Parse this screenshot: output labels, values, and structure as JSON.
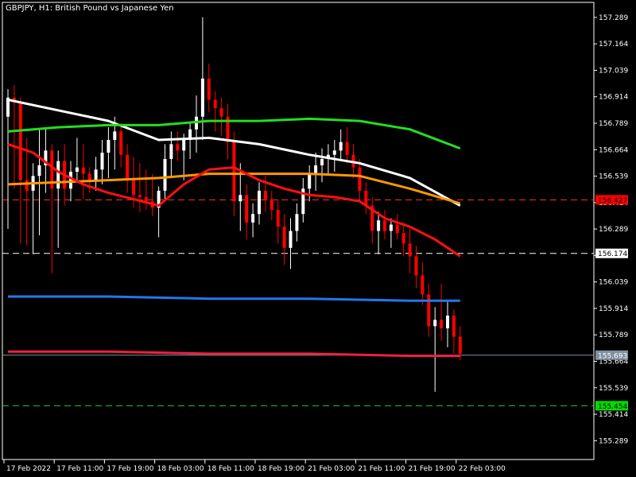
{
  "title": "GBPJPY, H1:  British Pound vs Japanese Yen",
  "colors": {
    "background": "#000000",
    "frame": "#ffffff",
    "bull_candle": "#ffffff",
    "bear_candle": "#ff0000",
    "current_price_line": "#8090a0",
    "ma_white": "#ffffff",
    "ma_green": "#22dd22",
    "ma_orange": "#ff9900",
    "ma_red": "#ff1010",
    "ma_blue": "#2277ee",
    "ma_crimson": "#ee2040"
  },
  "chart_data": {
    "type": "candlestick",
    "instrument": "GBPJPY",
    "timeframe": "H1",
    "ylim": [
      155.2,
      157.36
    ],
    "y_ticks": [
      "157.289",
      "157.164",
      "157.039",
      "156.914",
      "156.789",
      "156.664",
      "156.539",
      "156.414",
      "156.289",
      "156.164",
      "156.039",
      "155.914",
      "155.789",
      "155.664",
      "155.539",
      "155.414",
      "155.289"
    ],
    "x_ticks": [
      {
        "label": "17 Feb 2022",
        "bar": 0
      },
      {
        "label": "17 Feb 11:00",
        "bar": 8
      },
      {
        "label": "17 Feb 19:00",
        "bar": 16
      },
      {
        "label": "18 Feb 03:00",
        "bar": 24
      },
      {
        "label": "18 Feb 11:00",
        "bar": 32
      },
      {
        "label": "18 Feb 19:00",
        "bar": 40
      },
      {
        "label": "21 Feb 03:00",
        "bar": 48
      },
      {
        "label": "21 Feb 11:00",
        "bar": 56
      },
      {
        "label": "21 Feb 19:00",
        "bar": 64
      },
      {
        "label": "22 Feb 03:00",
        "bar": 72
      }
    ],
    "candles": [
      {
        "o": 156.82,
        "h": 156.95,
        "l": 156.29,
        "c": 156.91
      },
      {
        "o": 156.91,
        "h": 156.97,
        "l": 156.48,
        "c": 156.89
      },
      {
        "o": 156.89,
        "h": 156.91,
        "l": 156.22,
        "c": 156.52
      },
      {
        "o": 156.52,
        "h": 156.72,
        "l": 156.21,
        "c": 156.47
      },
      {
        "o": 156.47,
        "h": 156.6,
        "l": 156.17,
        "c": 156.54
      },
      {
        "o": 156.54,
        "h": 156.76,
        "l": 156.26,
        "c": 156.59
      },
      {
        "o": 156.59,
        "h": 156.77,
        "l": 156.46,
        "c": 156.66
      },
      {
        "o": 156.66,
        "h": 156.69,
        "l": 156.08,
        "c": 156.48
      },
      {
        "o": 156.48,
        "h": 156.66,
        "l": 156.2,
        "c": 156.61
      },
      {
        "o": 156.61,
        "h": 156.69,
        "l": 156.4,
        "c": 156.48
      },
      {
        "o": 156.48,
        "h": 156.61,
        "l": 156.42,
        "c": 156.56
      },
      {
        "o": 156.56,
        "h": 156.72,
        "l": 156.52,
        "c": 156.58
      },
      {
        "o": 156.58,
        "h": 156.69,
        "l": 156.43,
        "c": 156.55
      },
      {
        "o": 156.55,
        "h": 156.58,
        "l": 156.46,
        "c": 156.52
      },
      {
        "o": 156.52,
        "h": 156.63,
        "l": 156.47,
        "c": 156.57
      },
      {
        "o": 156.57,
        "h": 156.71,
        "l": 156.5,
        "c": 156.65
      },
      {
        "o": 156.65,
        "h": 156.77,
        "l": 156.53,
        "c": 156.71
      },
      {
        "o": 156.71,
        "h": 156.82,
        "l": 156.57,
        "c": 156.75
      },
      {
        "o": 156.75,
        "h": 156.79,
        "l": 156.58,
        "c": 156.64
      },
      {
        "o": 156.64,
        "h": 156.69,
        "l": 156.46,
        "c": 156.52
      },
      {
        "o": 156.52,
        "h": 156.63,
        "l": 156.39,
        "c": 156.45
      },
      {
        "o": 156.45,
        "h": 156.6,
        "l": 156.37,
        "c": 156.44
      },
      {
        "o": 156.44,
        "h": 156.57,
        "l": 156.38,
        "c": 156.42
      },
      {
        "o": 156.42,
        "h": 156.55,
        "l": 156.35,
        "c": 156.39
      },
      {
        "o": 156.39,
        "h": 156.49,
        "l": 156.25,
        "c": 156.47
      },
      {
        "o": 156.47,
        "h": 156.69,
        "l": 156.42,
        "c": 156.62
      },
      {
        "o": 156.62,
        "h": 156.75,
        "l": 156.53,
        "c": 156.69
      },
      {
        "o": 156.69,
        "h": 156.75,
        "l": 156.61,
        "c": 156.66
      },
      {
        "o": 156.66,
        "h": 156.74,
        "l": 156.52,
        "c": 156.71
      },
      {
        "o": 156.71,
        "h": 156.79,
        "l": 156.62,
        "c": 156.76
      },
      {
        "o": 156.76,
        "h": 156.92,
        "l": 156.65,
        "c": 156.82
      },
      {
        "o": 156.82,
        "h": 157.29,
        "l": 156.71,
        "c": 157.0
      },
      {
        "o": 157.0,
        "h": 157.07,
        "l": 156.84,
        "c": 156.9
      },
      {
        "o": 156.9,
        "h": 156.94,
        "l": 156.75,
        "c": 156.86
      },
      {
        "o": 156.86,
        "h": 156.91,
        "l": 156.73,
        "c": 156.82
      },
      {
        "o": 156.82,
        "h": 156.88,
        "l": 156.62,
        "c": 156.7
      },
      {
        "o": 156.7,
        "h": 156.75,
        "l": 156.35,
        "c": 156.42
      },
      {
        "o": 156.42,
        "h": 156.6,
        "l": 156.28,
        "c": 156.45
      },
      {
        "o": 156.45,
        "h": 156.5,
        "l": 156.24,
        "c": 156.32
      },
      {
        "o": 156.32,
        "h": 156.41,
        "l": 156.25,
        "c": 156.36
      },
      {
        "o": 156.36,
        "h": 156.51,
        "l": 156.31,
        "c": 156.47
      },
      {
        "o": 156.47,
        "h": 156.54,
        "l": 156.37,
        "c": 156.43
      },
      {
        "o": 156.43,
        "h": 156.47,
        "l": 156.33,
        "c": 156.38
      },
      {
        "o": 156.38,
        "h": 156.43,
        "l": 156.22,
        "c": 156.3
      },
      {
        "o": 156.3,
        "h": 156.36,
        "l": 156.12,
        "c": 156.2
      },
      {
        "o": 156.2,
        "h": 156.34,
        "l": 156.1,
        "c": 156.28
      },
      {
        "o": 156.28,
        "h": 156.41,
        "l": 156.23,
        "c": 156.36
      },
      {
        "o": 156.36,
        "h": 156.53,
        "l": 156.32,
        "c": 156.48
      },
      {
        "o": 156.48,
        "h": 156.59,
        "l": 156.42,
        "c": 156.55
      },
      {
        "o": 156.55,
        "h": 156.65,
        "l": 156.47,
        "c": 156.59
      },
      {
        "o": 156.59,
        "h": 156.67,
        "l": 156.51,
        "c": 156.62
      },
      {
        "o": 156.62,
        "h": 156.69,
        "l": 156.55,
        "c": 156.64
      },
      {
        "o": 156.64,
        "h": 156.71,
        "l": 156.56,
        "c": 156.66
      },
      {
        "o": 156.66,
        "h": 156.76,
        "l": 156.61,
        "c": 156.7
      },
      {
        "o": 156.7,
        "h": 156.77,
        "l": 156.6,
        "c": 156.64
      },
      {
        "o": 156.64,
        "h": 156.69,
        "l": 156.53,
        "c": 156.58
      },
      {
        "o": 156.58,
        "h": 156.62,
        "l": 156.42,
        "c": 156.47
      },
      {
        "o": 156.47,
        "h": 156.51,
        "l": 156.36,
        "c": 156.4
      },
      {
        "o": 156.4,
        "h": 156.44,
        "l": 156.22,
        "c": 156.28
      },
      {
        "o": 156.28,
        "h": 156.37,
        "l": 156.17,
        "c": 156.33
      },
      {
        "o": 156.33,
        "h": 156.38,
        "l": 156.24,
        "c": 156.28
      },
      {
        "o": 156.28,
        "h": 156.34,
        "l": 156.2,
        "c": 156.31
      },
      {
        "o": 156.31,
        "h": 156.36,
        "l": 156.24,
        "c": 156.27
      },
      {
        "o": 156.27,
        "h": 156.32,
        "l": 156.16,
        "c": 156.22
      },
      {
        "o": 156.22,
        "h": 156.29,
        "l": 156.08,
        "c": 156.16
      },
      {
        "o": 156.16,
        "h": 156.21,
        "l": 156.01,
        "c": 156.07
      },
      {
        "o": 156.07,
        "h": 156.13,
        "l": 155.93,
        "c": 155.98
      },
      {
        "o": 155.98,
        "h": 156.03,
        "l": 155.78,
        "c": 155.83
      },
      {
        "o": 155.83,
        "h": 155.92,
        "l": 155.52,
        "c": 155.86
      },
      {
        "o": 155.86,
        "h": 156.03,
        "l": 155.76,
        "c": 155.82
      },
      {
        "o": 155.82,
        "h": 155.95,
        "l": 155.73,
        "c": 155.88
      },
      {
        "o": 155.88,
        "h": 155.91,
        "l": 155.7,
        "c": 155.78
      },
      {
        "o": 155.78,
        "h": 155.83,
        "l": 155.67,
        "c": 155.7
      }
    ],
    "moving_averages": [
      {
        "color": "#ffffff",
        "points": [
          [
            0,
            156.9
          ],
          [
            8,
            156.85
          ],
          [
            16,
            156.8
          ],
          [
            24,
            156.71
          ],
          [
            32,
            156.72
          ],
          [
            40,
            156.69
          ],
          [
            48,
            156.64
          ],
          [
            56,
            156.6
          ],
          [
            64,
            156.53
          ],
          [
            72,
            156.4
          ]
        ]
      },
      {
        "color": "#22dd22",
        "points": [
          [
            0,
            156.75
          ],
          [
            8,
            156.77
          ],
          [
            16,
            156.78
          ],
          [
            24,
            156.78
          ],
          [
            32,
            156.8
          ],
          [
            40,
            156.8
          ],
          [
            48,
            156.81
          ],
          [
            56,
            156.8
          ],
          [
            64,
            156.76
          ],
          [
            72,
            156.67
          ]
        ]
      },
      {
        "color": "#ff9900",
        "points": [
          [
            0,
            156.5
          ],
          [
            8,
            156.51
          ],
          [
            16,
            156.52
          ],
          [
            24,
            156.53
          ],
          [
            32,
            156.55
          ],
          [
            40,
            156.55
          ],
          [
            48,
            156.55
          ],
          [
            56,
            156.54
          ],
          [
            64,
            156.48
          ],
          [
            72,
            156.41
          ]
        ]
      },
      {
        "color": "#ff1010",
        "points": [
          [
            0,
            156.69
          ],
          [
            4,
            156.65
          ],
          [
            8,
            156.56
          ],
          [
            12,
            156.5
          ],
          [
            16,
            156.46
          ],
          [
            20,
            156.43
          ],
          [
            24,
            156.4
          ],
          [
            28,
            156.5
          ],
          [
            32,
            156.57
          ],
          [
            36,
            156.58
          ],
          [
            40,
            156.52
          ],
          [
            44,
            156.48
          ],
          [
            48,
            156.45
          ],
          [
            52,
            156.44
          ],
          [
            56,
            156.42
          ],
          [
            60,
            156.34
          ],
          [
            64,
            156.3
          ],
          [
            68,
            156.24
          ],
          [
            72,
            156.16
          ]
        ]
      },
      {
        "color": "#2277ee",
        "points": [
          [
            0,
            155.97
          ],
          [
            16,
            155.97
          ],
          [
            32,
            155.96
          ],
          [
            48,
            155.96
          ],
          [
            64,
            155.95
          ],
          [
            72,
            155.95
          ]
        ]
      },
      {
        "color": "#ee2040",
        "points": [
          [
            0,
            155.71
          ],
          [
            16,
            155.71
          ],
          [
            32,
            155.7
          ],
          [
            48,
            155.7
          ],
          [
            64,
            155.69
          ],
          [
            72,
            155.69
          ]
        ]
      }
    ],
    "levels": [
      {
        "value": "156.427",
        "color": "#ff3030",
        "label_bg": "#ff0000",
        "label_color": "#000000",
        "dash": "8,5"
      },
      {
        "value": "156.174",
        "color": "#ffffff",
        "label_bg": "#ffffff",
        "label_color": "#000000",
        "dash": "8,5"
      },
      {
        "value": "155.693",
        "color": "#8090a0",
        "label_bg": "#8090a0",
        "label_color": "#ffffff",
        "dash": ""
      },
      {
        "value": "155.454",
        "color": "#22cc22",
        "label_bg": "#00dd00",
        "label_color": "#000000",
        "dash": "8,5"
      }
    ]
  }
}
